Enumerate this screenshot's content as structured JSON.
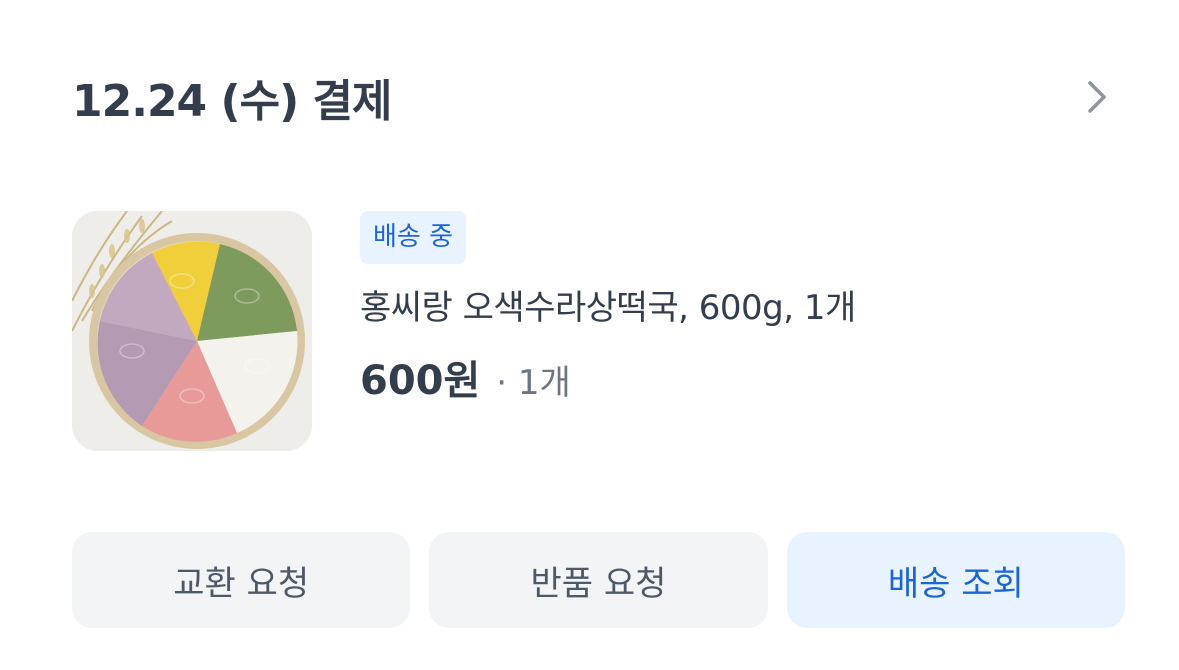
{
  "order": {
    "header_title": "12.24 (수) 결제",
    "chevron_icon": "chevron-right-icon"
  },
  "item": {
    "image_icon": "rice-cake-product-photo",
    "status_badge": "배송 중",
    "name": "홍씨랑 오색수라상떡국, 600g, 1개",
    "price": "600원",
    "quantity": "· 1개"
  },
  "actions": {
    "exchange_label": "교환 요청",
    "return_label": "반품 요청",
    "tracking_label": "배송 조회"
  },
  "colors": {
    "title": "#333d4b",
    "badge_bg": "#e8f3ff",
    "badge_text": "#1b64da",
    "button_bg": "#f2f4f6",
    "button_text": "#4e5968",
    "primary_button_bg": "#e8f3ff",
    "primary_button_text": "#1b64da"
  }
}
